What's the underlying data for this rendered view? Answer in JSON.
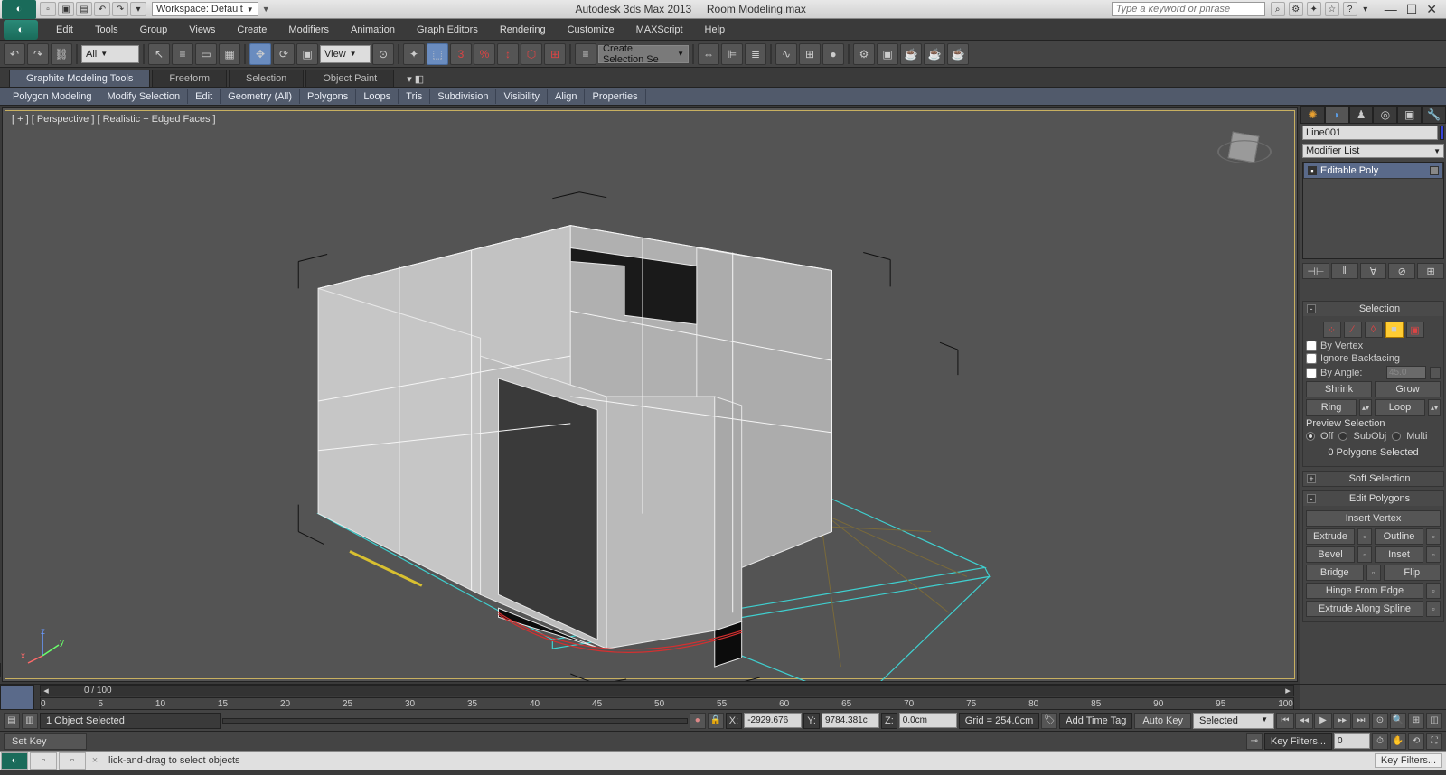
{
  "title": {
    "app": "Autodesk 3ds Max  2013",
    "file": "Room Modeling.max",
    "workspace_label": "Workspace: Default",
    "search_placeholder": "Type a keyword or phrase"
  },
  "menus": [
    "Edit",
    "Tools",
    "Group",
    "Views",
    "Create",
    "Modifiers",
    "Animation",
    "Graph Editors",
    "Rendering",
    "Customize",
    "MAXScript",
    "Help"
  ],
  "toolbar": {
    "filter_all": "All",
    "refcoord": "View",
    "create_set": "Create Selection Se"
  },
  "ribbon": {
    "tabs": [
      "Graphite Modeling Tools",
      "Freeform",
      "Selection",
      "Object Paint"
    ],
    "sub": [
      "Polygon Modeling",
      "Modify Selection",
      "Edit",
      "Geometry (All)",
      "Polygons",
      "Loops",
      "Tris",
      "Subdivision",
      "Visibility",
      "Align",
      "Properties"
    ]
  },
  "viewport": {
    "label": "[ + ] [ Perspective ] [ Realistic + Edged Faces ]"
  },
  "command_panel": {
    "object_name": "Line001",
    "modifier_list_label": "Modifier List",
    "stack_item": "Editable Poly",
    "selection": {
      "title": "Selection",
      "by_vertex": "By Vertex",
      "ignore_backfacing": "Ignore Backfacing",
      "by_angle": "By Angle:",
      "angle_value": "45.0",
      "shrink": "Shrink",
      "grow": "Grow",
      "ring": "Ring",
      "loop": "Loop",
      "preview_label": "Preview Selection",
      "off": "Off",
      "subobj": "SubObj",
      "multi": "Multi",
      "status": "0 Polygons Selected"
    },
    "soft_selection": "Soft Selection",
    "edit_polygons": {
      "title": "Edit Polygons",
      "insert_vertex": "Insert Vertex",
      "extrude": "Extrude",
      "outline": "Outline",
      "bevel": "Bevel",
      "inset": "Inset",
      "bridge": "Bridge",
      "flip": "Flip",
      "hinge": "Hinge From Edge",
      "extrude_spline": "Extrude Along Spline"
    }
  },
  "timeline": {
    "range_label": "0 / 100",
    "ticks": [
      "0",
      "5",
      "10",
      "15",
      "20",
      "25",
      "30",
      "35",
      "40",
      "45",
      "50",
      "55",
      "60",
      "65",
      "70",
      "75",
      "80",
      "85",
      "90",
      "95",
      "100"
    ]
  },
  "status": {
    "selected": "1 Object Selected",
    "x": "-2929.676",
    "y": "9784.381c",
    "z": "0.0cm",
    "grid": "Grid = 254.0cm",
    "add_time_tag": "Add Time Tag",
    "auto_key": "Auto Key",
    "set_key": "Set Key",
    "selected_dd": "Selected",
    "key_filters": "Key Filters..."
  },
  "prompt": {
    "text": "lick-and-drag to select objects"
  }
}
